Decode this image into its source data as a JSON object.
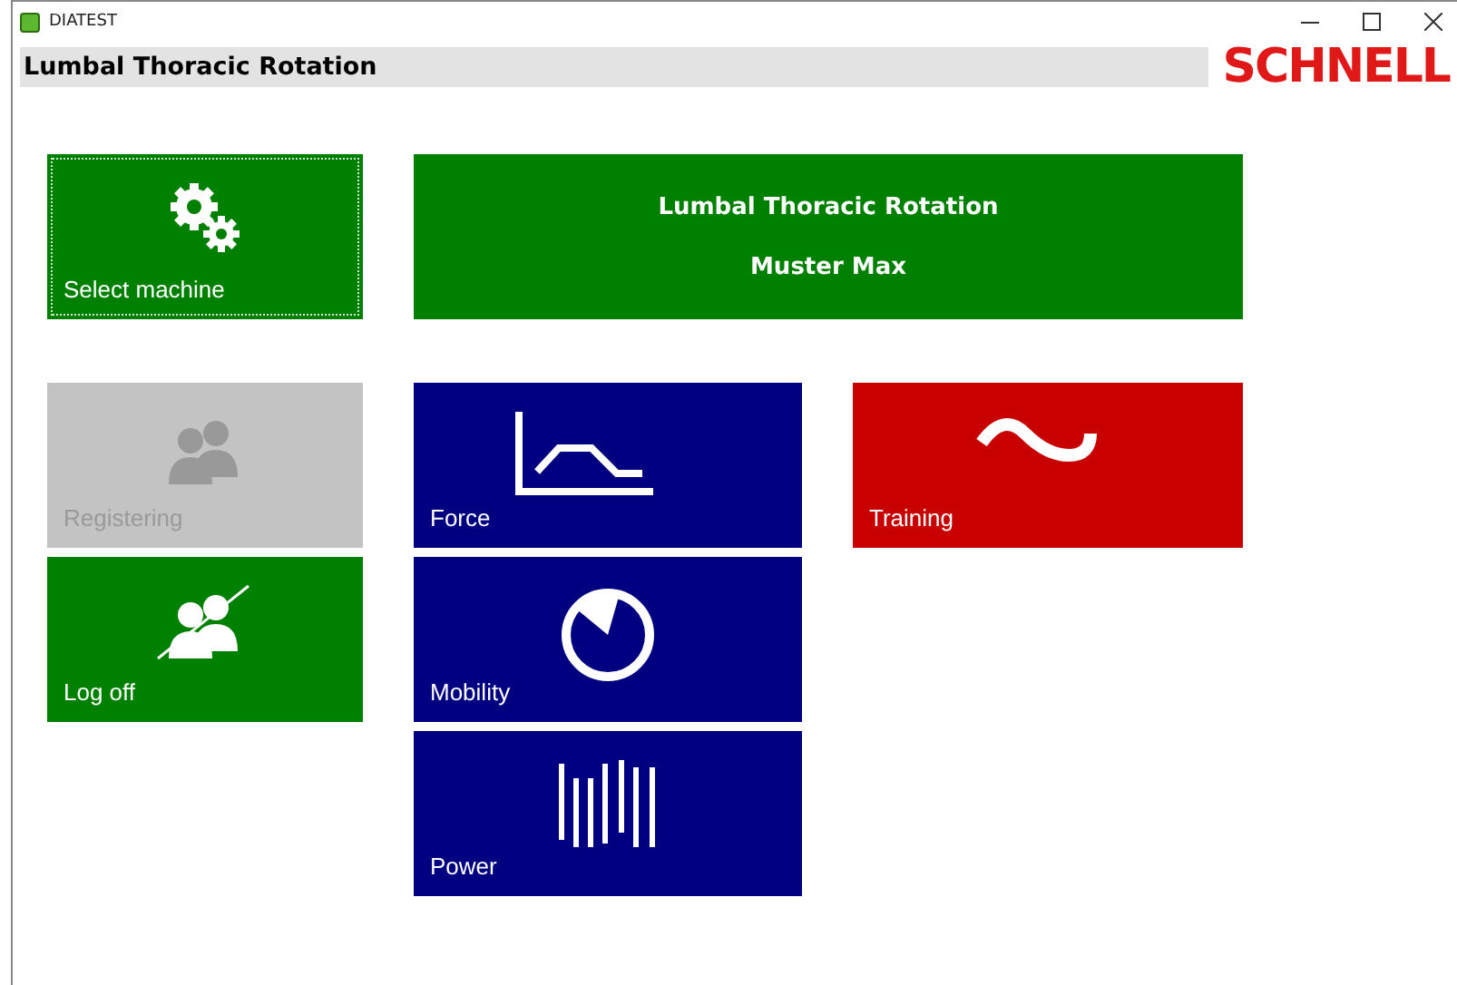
{
  "window": {
    "title": "DIATEST"
  },
  "header": {
    "title": "Lumbal Thoracic Rotation",
    "logo": "SCHNELL"
  },
  "banner": {
    "title": "Lumbal Thoracic Rotation",
    "subtitle": "Muster Max"
  },
  "tiles": [
    {
      "kind": "machine",
      "label": "Select machine",
      "color": "#008000",
      "disabled": false,
      "focused": true
    },
    {
      "kind": "register",
      "label": "Registering",
      "color": "#c3c3c3",
      "disabled": true,
      "focused": false
    },
    {
      "kind": "logoff",
      "label": "Log off",
      "color": "#008000",
      "disabled": false,
      "focused": false
    },
    {
      "kind": "force",
      "label": "Force",
      "color": "#000080",
      "disabled": false,
      "focused": false
    },
    {
      "kind": "mobility",
      "label": "Mobility",
      "color": "#000080",
      "disabled": false,
      "focused": false
    },
    {
      "kind": "power",
      "label": "Power",
      "color": "#000080",
      "disabled": false,
      "focused": false
    },
    {
      "kind": "training",
      "label": "Training",
      "color": "#c80000",
      "disabled": false,
      "focused": false
    }
  ]
}
